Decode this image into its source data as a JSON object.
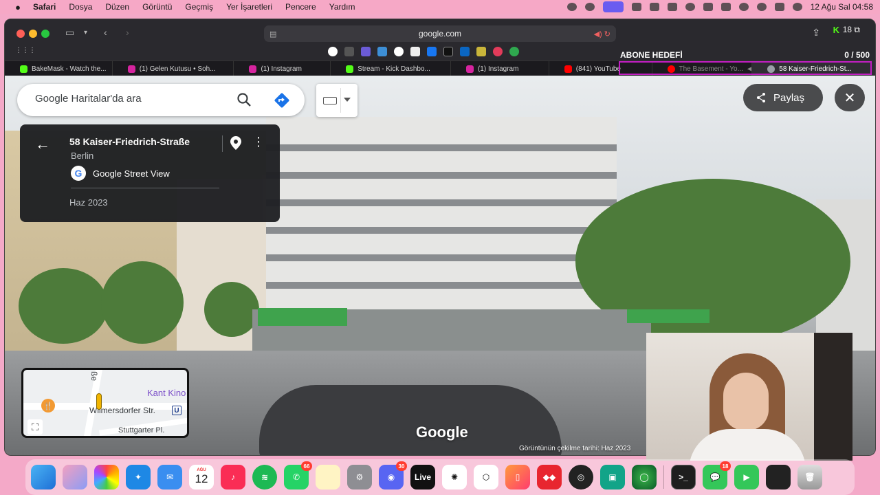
{
  "menubar": {
    "items": [
      "Safari",
      "Dosya",
      "Düzen",
      "Görüntü",
      "Geçmiş",
      "Yer İşaretleri",
      "Pencere",
      "Yardım"
    ],
    "datetime": "12 Ağu Sal  04:58"
  },
  "browser": {
    "url": "google.com",
    "tab_count": "18",
    "kick_icon_label": "K",
    "overlay": {
      "title": "ABONE HEDEFİ",
      "count": "0  / 500"
    },
    "tabs": [
      {
        "label": "BakeMask - Watch the...",
        "color": "#53fc18"
      },
      {
        "label": "(1) Gelen Kutusu • Soh...",
        "color": "#d6249f"
      },
      {
        "label": "(1) Instagram",
        "color": "#d6249f"
      },
      {
        "label": "Stream - Kick Dashbo...",
        "color": "#53fc18"
      },
      {
        "label": "(1) Instagram",
        "color": "#d6249f"
      },
      {
        "label": "(841) YouTube",
        "color": "#ff0000"
      },
      {
        "label": "The Basement - Yo...",
        "color": "#ff0000"
      },
      {
        "label": "58 Kaiser-Friedrich-St...",
        "color": "#9aa0a6"
      }
    ]
  },
  "maps": {
    "search_placeholder": "Google Haritalar'da ara",
    "share_label": "Paylaş",
    "place": {
      "title": "58 Kaiser-Friedrich-Straße",
      "city": "Berlin",
      "source": "Google Street View",
      "date": "Haz 2023"
    },
    "minimap": {
      "street_top": "ße",
      "poi": "Kant Kino",
      "street_main": "Wilmersdorfer Str.",
      "street_bottom": "Stuttgarter Pl.",
      "transit": "U"
    },
    "logo": "Google",
    "capture_date": "Görüntünün çekilme tarihi: Haz 2023"
  },
  "dock": {
    "calendar_month": "AĞU",
    "calendar_day": "12",
    "whatsapp_badge": "66",
    "discord_badge": "30",
    "messages_badge": "18",
    "live_label": "Live"
  }
}
